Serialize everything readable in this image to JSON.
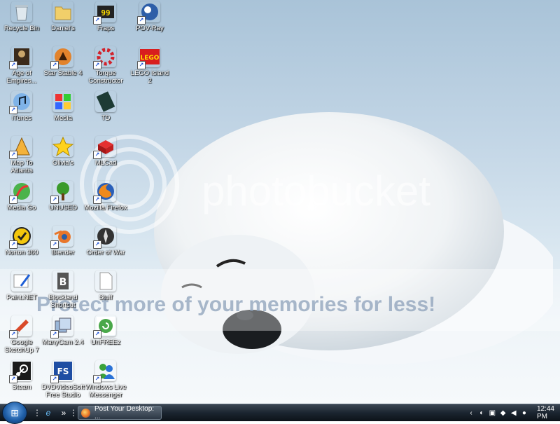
{
  "desktop": {
    "icons": [
      {
        "label": "Recycle Bin",
        "glyph": "recycle-bin-icon"
      },
      {
        "label": "Daniel's",
        "glyph": "folder-icon"
      },
      {
        "label": "Fraps",
        "glyph": "fraps-icon",
        "badge": "99"
      },
      {
        "label": "POV-Ray",
        "glyph": "povray-icon"
      },
      {
        "label": "Age of Empires...",
        "glyph": "age-of-empires-icon"
      },
      {
        "label": "Star Stable 4",
        "glyph": "star-stable-icon"
      },
      {
        "label": "Torque Constructor",
        "glyph": "torque-icon"
      },
      {
        "label": "LEGO Island 2",
        "glyph": "lego-icon",
        "badge": "LEGO"
      },
      {
        "label": "iTunes",
        "glyph": "itunes-icon"
      },
      {
        "label": "Media",
        "glyph": "media-icon"
      },
      {
        "label": "TD",
        "glyph": "film-icon"
      },
      {
        "label": "Map To Atlantis",
        "glyph": "map-icon"
      },
      {
        "label": "Olivia's",
        "glyph": "star-icon"
      },
      {
        "label": "MLCad",
        "glyph": "mlcad-icon"
      },
      {
        "label": "Media Go",
        "glyph": "media-go-icon"
      },
      {
        "label": "UNUSED",
        "glyph": "tree-icon"
      },
      {
        "label": "Mozilla Firefox",
        "glyph": "firefox-icon"
      },
      {
        "label": "Norton 360",
        "glyph": "norton-icon"
      },
      {
        "label": "Blender",
        "glyph": "blender-icon"
      },
      {
        "label": "Order of War",
        "glyph": "order-of-war-icon"
      },
      {
        "label": "Paint.NET",
        "glyph": "paint-icon"
      },
      {
        "label": "Blockland Shortcut",
        "glyph": "blockland-icon"
      },
      {
        "label": "Stuff",
        "glyph": "document-icon"
      },
      {
        "label": "Google SketchUp 7",
        "glyph": "sketchup-icon"
      },
      {
        "label": "ManyCam 2.4",
        "glyph": "manycam-icon"
      },
      {
        "label": "UnFREEz",
        "glyph": "unfreez-icon"
      },
      {
        "label": "Steam",
        "glyph": "steam-icon"
      },
      {
        "label": "DVDVideoSoft Free Studio",
        "glyph": "dvdvideosoft-icon",
        "badge": "FS"
      },
      {
        "label": "Windows Live Messenger",
        "glyph": "messenger-icon"
      }
    ]
  },
  "watermark": {
    "brand": "photobucket",
    "slogan": "Protect more of your memories for less!"
  },
  "taskbar": {
    "active_task": "Post Your Desktop: ...",
    "overflow": "»",
    "clock": "12:44 PM"
  },
  "colors": {
    "sky": "#a9c3d8",
    "taskbar": "#1b2530",
    "watermark": "#ffffff"
  }
}
